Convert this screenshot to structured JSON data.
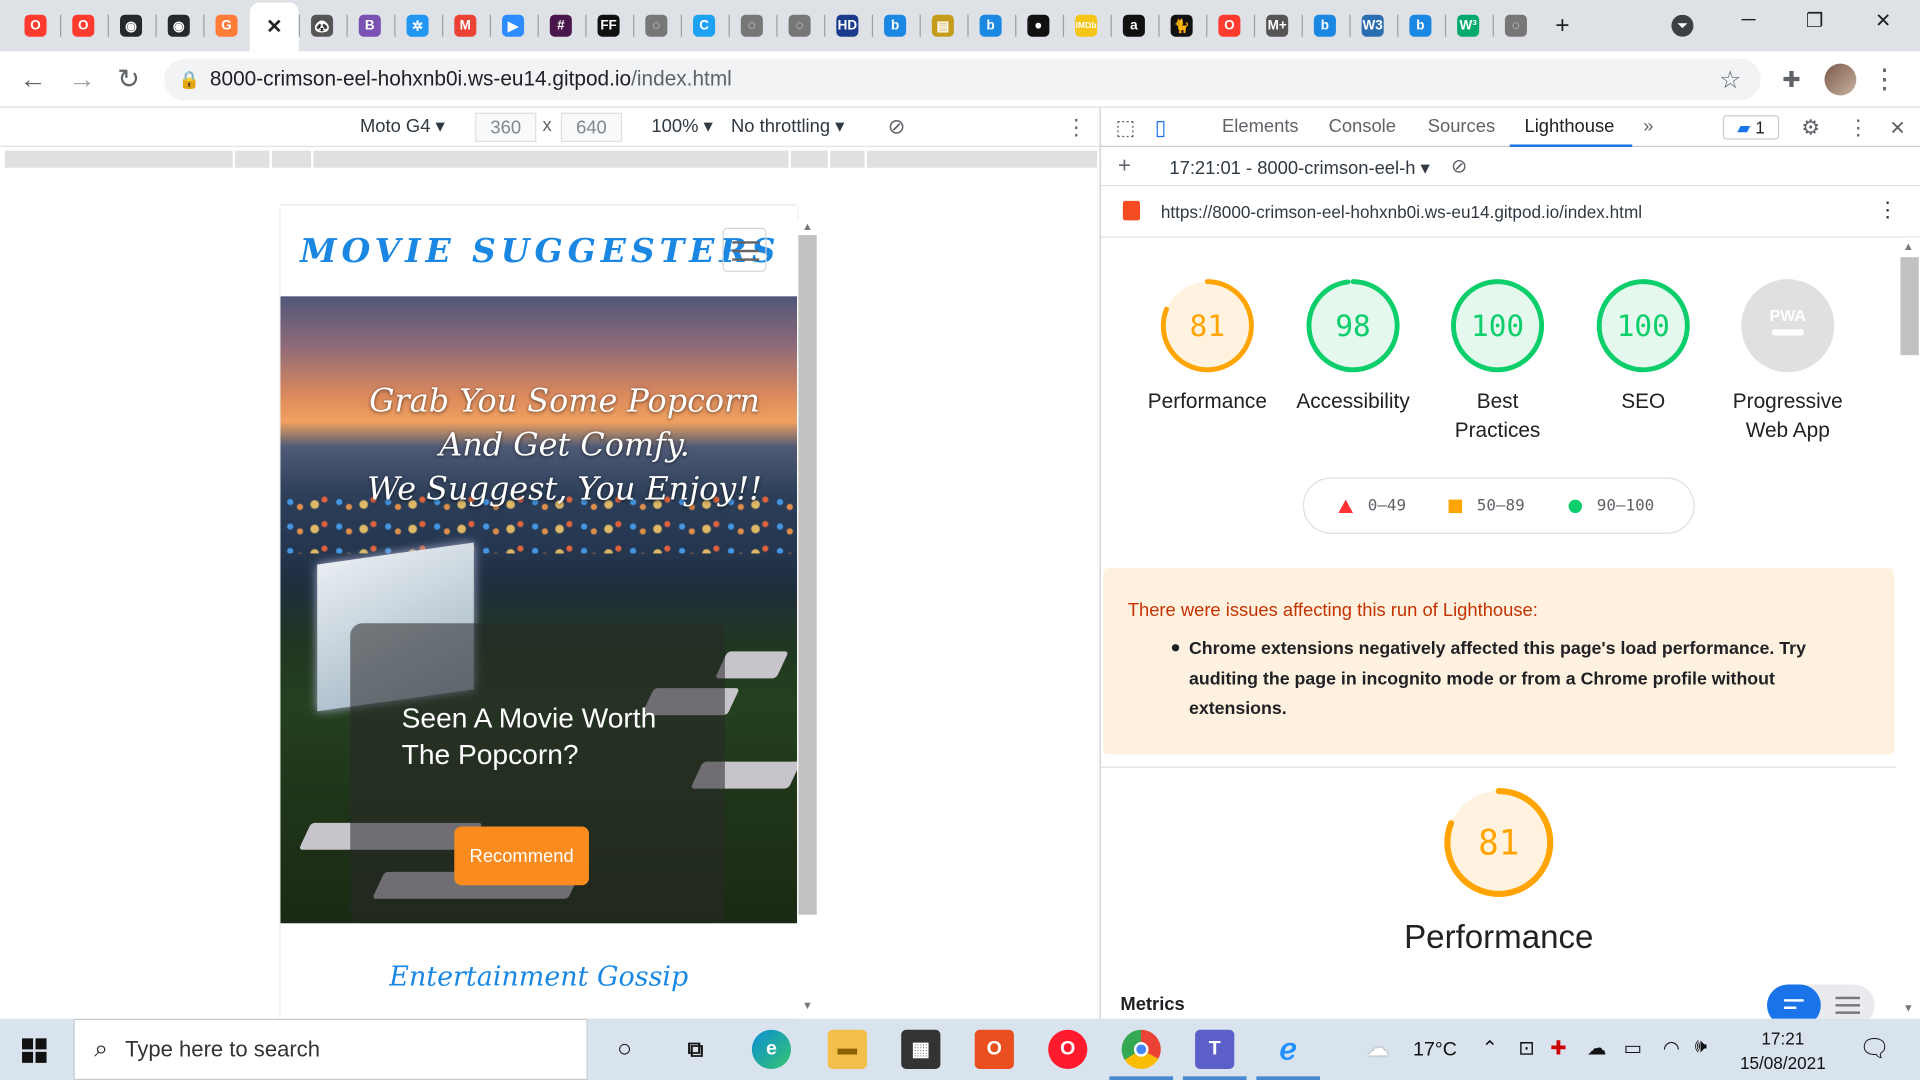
{
  "browser": {
    "tab_favicons": [
      {
        "name": "opera-icon",
        "color": "#ff3b30",
        "glyph": "O"
      },
      {
        "name": "opera-icon",
        "color": "#ff3b30",
        "glyph": "O"
      },
      {
        "name": "github-icon",
        "color": "#24292e",
        "glyph": "◉"
      },
      {
        "name": "github-icon",
        "color": "#24292e",
        "glyph": "◉"
      },
      {
        "name": "grammarly-icon",
        "color": "#ff7b38",
        "glyph": "G"
      },
      {
        "name": "close-icon",
        "color": "#ffffff",
        "glyph": "✕"
      },
      {
        "name": "panda-icon",
        "color": "#555555",
        "glyph": "🐼"
      },
      {
        "name": "bootstrap-icon",
        "color": "#7952b3",
        "glyph": "B"
      },
      {
        "name": "slack-multicolor-icon",
        "color": "#2196f3",
        "glyph": "✲"
      },
      {
        "name": "gmail-icon",
        "color": "#ea4335",
        "glyph": "M"
      },
      {
        "name": "zoom-icon",
        "color": "#2d8cff",
        "glyph": "▶"
      },
      {
        "name": "slack-icon",
        "color": "#4a154b",
        "glyph": "#"
      },
      {
        "name": "ff-icon",
        "color": "#111111",
        "glyph": "FF"
      },
      {
        "name": "globe-icon",
        "color": "#777777",
        "glyph": "◌"
      },
      {
        "name": "c-icon",
        "color": "#1da1f2",
        "glyph": "C"
      },
      {
        "name": "globe-icon",
        "color": "#777777",
        "glyph": "◌"
      },
      {
        "name": "globe-icon",
        "color": "#777777",
        "glyph": "◌"
      },
      {
        "name": "hd-icon",
        "color": "#1a3b8c",
        "glyph": "HD"
      },
      {
        "name": "bing-icon",
        "color": "#1a88e2",
        "glyph": "b"
      },
      {
        "name": "ticket-icon",
        "color": "#c59b1b",
        "glyph": "▤"
      },
      {
        "name": "bing-icon",
        "color": "#1a88e2",
        "glyph": "b"
      },
      {
        "name": "circle-icon",
        "color": "#111111",
        "glyph": "●"
      },
      {
        "name": "imdb-icon",
        "color": "#f5c518",
        "glyph": "IMDb"
      },
      {
        "name": "amazon-icon",
        "color": "#111111",
        "glyph": "a"
      },
      {
        "name": "cat-icon",
        "color": "#111111",
        "glyph": "🐈"
      },
      {
        "name": "opera-icon",
        "color": "#ff3b30",
        "glyph": "O"
      },
      {
        "name": "markdown-icon",
        "color": "#555555",
        "glyph": "M+"
      },
      {
        "name": "bing-icon",
        "color": "#1a88e2",
        "glyph": "b"
      },
      {
        "name": "w3-icon",
        "color": "#2a6db0",
        "glyph": "W3"
      },
      {
        "name": "bing-icon",
        "color": "#1a88e2",
        "glyph": "b"
      },
      {
        "name": "w3schools-icon",
        "color": "#04aa6d",
        "glyph": "W³"
      },
      {
        "name": "globe-icon",
        "color": "#777777",
        "glyph": "◌"
      }
    ],
    "address_main": "8000-crimson-eel-hohxnb0i.ws-eu14.gitpod.io",
    "address_path": "/index.html"
  },
  "device_toolbar": {
    "device": "Moto G4",
    "width": "360",
    "times": "x",
    "height": "640",
    "zoom": "100%",
    "throttling": "No throttling"
  },
  "site": {
    "brand": "MOVIE SUGGESTERS",
    "hero_heading_1": "Grab You Some Popcorn And Get Comfy.",
    "hero_heading_2": "We Suggest, You Enjoy!!",
    "card_title": "Seen A Movie Worth The Popcorn?",
    "recommend_button": "Recommend",
    "section_title": "Entertainment Gossip"
  },
  "devtools": {
    "tabs": [
      "Elements",
      "Console",
      "Sources",
      "Lighthouse"
    ],
    "active_tab": "Lighthouse",
    "more": "»",
    "issues_count": "1",
    "report_label": "17:21:01 - 8000-crimson-eel-h",
    "report_url": "https://8000-crimson-eel-hohxnb0i.ws-eu14.gitpod.io/index.html",
    "gauges": [
      {
        "score": 81,
        "label_1": "Performance",
        "label_2": "",
        "color": "#ffa400",
        "fill": "#fff3e0"
      },
      {
        "score": 98,
        "label_1": "Accessibility",
        "label_2": "",
        "color": "#0cce6b",
        "fill": "#e5f8ee"
      },
      {
        "score": 100,
        "label_1": "Best",
        "label_2": "Practices",
        "color": "#0cce6b",
        "fill": "#e5f8ee"
      },
      {
        "score": 100,
        "label_1": "SEO",
        "label_2": "",
        "color": "#0cce6b",
        "fill": "#e5f8ee"
      }
    ],
    "pwa": {
      "label_1": "Progressive",
      "label_2": "Web App",
      "badge": "PWA"
    },
    "legend": [
      {
        "range": "0–49",
        "color": "#ff3333",
        "shape": "triangle"
      },
      {
        "range": "50–89",
        "color": "#ffa400",
        "shape": "square"
      },
      {
        "range": "90–100",
        "color": "#0cce6b",
        "shape": "circle"
      }
    ],
    "warning_title": "There were issues affecting this run of Lighthouse:",
    "warning_message": "Chrome extensions negatively affected this page's load performance. Try auditing the page in incognito mode or from a Chrome profile without extensions.",
    "performance_score": 81,
    "performance_title": "Performance",
    "metrics_label": "Metrics"
  },
  "taskbar": {
    "search_placeholder": "Type here to search",
    "weather": "17°C",
    "time": "17:21",
    "date": "15/08/2021"
  }
}
